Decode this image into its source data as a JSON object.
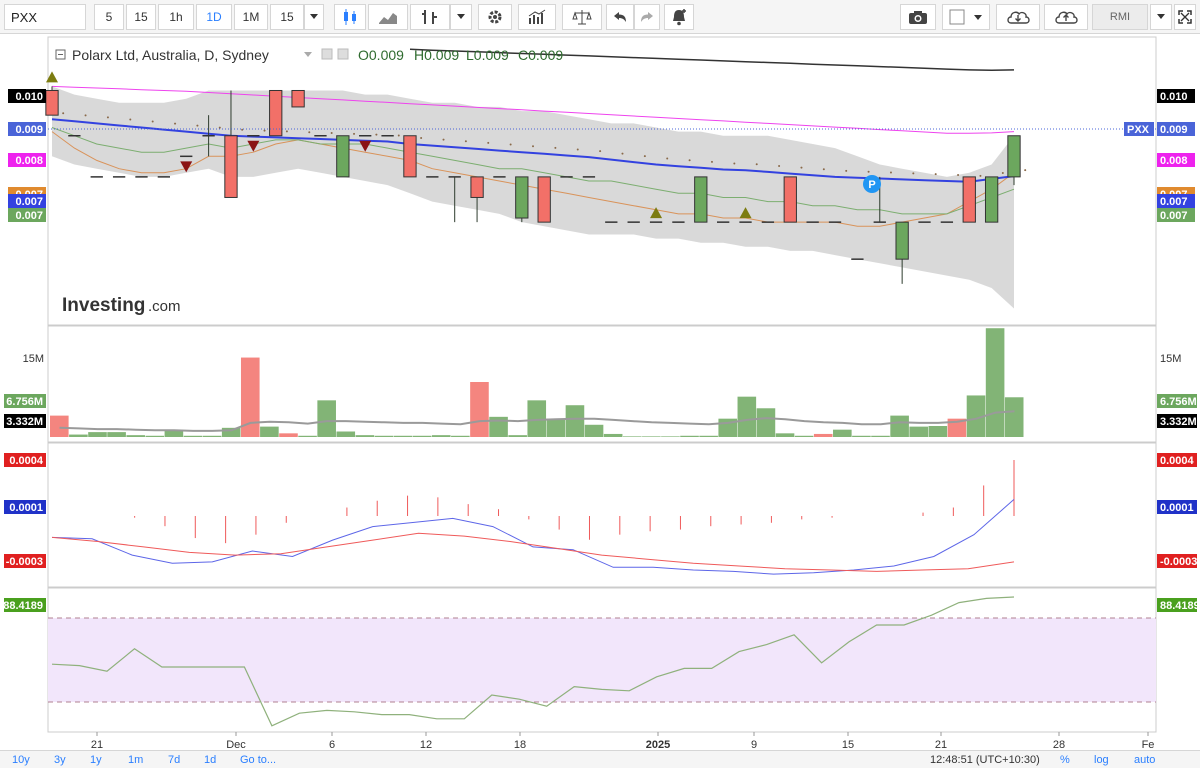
{
  "toolbar": {
    "symbol": "PXX",
    "intervals": [
      "5",
      "15",
      "1h",
      "1D",
      "1M",
      "15"
    ],
    "active_interval": "1D",
    "indicator_label": "RMI",
    "icons": [
      "candles-icon",
      "area-icon",
      "bars-icon",
      "dropdown-icon",
      "settings-icon",
      "indicators-icon",
      "compare-icon",
      "undo-icon",
      "redo-icon",
      "alert-icon",
      "camera-icon",
      "color-box-icon",
      "cloud-download-icon",
      "cloud-upload-icon"
    ]
  },
  "legend": {
    "title": "Polarx Ltd, Australia, D, Sydney",
    "open": "O0.009",
    "high": "H0.009",
    "low": "L0.009",
    "close": "C0.009"
  },
  "watermark": {
    "brand": "Investing",
    "suffix": ".com"
  },
  "colors": {
    "up": "#6ca75e",
    "down": "#f27068",
    "ma_blue": "#3342e0",
    "ma_magenta": "#ee44ee",
    "ma_dark": "#333333",
    "ma_green": "#7cae70",
    "ma_orange": "#d9935a",
    "bb_fill": "#d5d5d5",
    "macd": "#5d66e8",
    "signal": "#ef5a5a",
    "rsi": "#8fb17c",
    "rsi_zone": "#f2e6fb",
    "accent": "#2a7fff"
  },
  "chart_data": [
    {
      "type": "candlestick",
      "title": "Polarx Ltd, Australia, D, Sydney",
      "ylim": [
        0.0039,
        0.0109
      ],
      "axis_labels_right": [
        {
          "value": "0.010",
          "color": "#000000"
        },
        {
          "value": "0.009",
          "color": "#4a64d8"
        },
        {
          "value": "0.008",
          "color": "#ee22ee"
        },
        {
          "value": "0.007",
          "color": "#e08a2e"
        },
        {
          "value": "0.007",
          "color": "#3342e0"
        },
        {
          "value": "0.007",
          "color": "#6ca75e"
        }
      ],
      "price_tag": "PXX",
      "x_ticks": [
        "21",
        "Dec",
        "6",
        "12",
        "18",
        "2025",
        "9",
        "15",
        "21",
        "28",
        "Fe"
      ],
      "candles": [
        {
          "o": 0.0096,
          "h": 0.0097,
          "l": 0.009,
          "c": 0.009
        },
        {
          "o": 0.0085,
          "h": 0.0085,
          "l": 0.0085,
          "c": 0.0085
        },
        {
          "o": 0.0075,
          "h": 0.0075,
          "l": 0.0075,
          "c": 0.0075
        },
        {
          "o": 0.0075,
          "h": 0.0075,
          "l": 0.0075,
          "c": 0.0075
        },
        {
          "o": 0.0075,
          "h": 0.0075,
          "l": 0.0075,
          "c": 0.0075
        },
        {
          "o": 0.0075,
          "h": 0.0075,
          "l": 0.0075,
          "c": 0.0075
        },
        {
          "o": 0.008,
          "h": 0.008,
          "l": 0.008,
          "c": 0.008
        },
        {
          "o": 0.0085,
          "h": 0.009,
          "l": 0.008,
          "c": 0.0085
        },
        {
          "o": 0.0085,
          "h": 0.0096,
          "l": 0.007,
          "c": 0.007
        },
        {
          "o": 0.0085,
          "h": 0.0085,
          "l": 0.0085,
          "c": 0.0085
        },
        {
          "o": 0.0096,
          "h": 0.0096,
          "l": 0.0085,
          "c": 0.0085
        },
        {
          "o": 0.0096,
          "h": 0.0096,
          "l": 0.0092,
          "c": 0.0092
        },
        {
          "o": 0.0085,
          "h": 0.0085,
          "l": 0.0085,
          "c": 0.0085
        },
        {
          "o": 0.0075,
          "h": 0.0085,
          "l": 0.0075,
          "c": 0.0085
        },
        {
          "o": 0.0085,
          "h": 0.0085,
          "l": 0.0085,
          "c": 0.0085
        },
        {
          "o": 0.0085,
          "h": 0.0085,
          "l": 0.0085,
          "c": 0.0085
        },
        {
          "o": 0.0085,
          "h": 0.0085,
          "l": 0.0075,
          "c": 0.0075
        },
        {
          "o": 0.0075,
          "h": 0.0075,
          "l": 0.0075,
          "c": 0.0075
        },
        {
          "o": 0.0075,
          "h": 0.0075,
          "l": 0.0064,
          "c": 0.0075
        },
        {
          "o": 0.0075,
          "h": 0.0075,
          "l": 0.0064,
          "c": 0.007
        },
        {
          "o": 0.0075,
          "h": 0.0075,
          "l": 0.0075,
          "c": 0.0075
        },
        {
          "o": 0.0065,
          "h": 0.0075,
          "l": 0.0064,
          "c": 0.0075
        },
        {
          "o": 0.0075,
          "h": 0.0075,
          "l": 0.0064,
          "c": 0.0064
        },
        {
          "o": 0.0075,
          "h": 0.0075,
          "l": 0.0075,
          "c": 0.0075
        },
        {
          "o": 0.0075,
          "h": 0.0075,
          "l": 0.0075,
          "c": 0.0075
        },
        {
          "o": 0.0064,
          "h": 0.0064,
          "l": 0.0064,
          "c": 0.0064
        },
        {
          "o": 0.0064,
          "h": 0.0064,
          "l": 0.0064,
          "c": 0.0064
        },
        {
          "o": 0.0064,
          "h": 0.0064,
          "l": 0.0064,
          "c": 0.0064
        },
        {
          "o": 0.0064,
          "h": 0.0064,
          "l": 0.0064,
          "c": 0.0064
        },
        {
          "o": 0.0064,
          "h": 0.0075,
          "l": 0.0064,
          "c": 0.0075
        },
        {
          "o": 0.0064,
          "h": 0.0064,
          "l": 0.0064,
          "c": 0.0064
        },
        {
          "o": 0.0064,
          "h": 0.0064,
          "l": 0.0064,
          "c": 0.0064
        },
        {
          "o": 0.0064,
          "h": 0.0064,
          "l": 0.0064,
          "c": 0.0064
        },
        {
          "o": 0.0075,
          "h": 0.0075,
          "l": 0.0064,
          "c": 0.0064
        },
        {
          "o": 0.0064,
          "h": 0.0064,
          "l": 0.0064,
          "c": 0.0064
        },
        {
          "o": 0.0064,
          "h": 0.0064,
          "l": 0.0064,
          "c": 0.0064
        },
        {
          "o": 0.0055,
          "h": 0.0055,
          "l": 0.0055,
          "c": 0.0055
        },
        {
          "o": 0.0064,
          "h": 0.0075,
          "l": 0.0064,
          "c": 0.0064
        },
        {
          "o": 0.0055,
          "h": 0.0064,
          "l": 0.0049,
          "c": 0.0064
        },
        {
          "o": 0.0064,
          "h": 0.0064,
          "l": 0.0064,
          "c": 0.0064
        },
        {
          "o": 0.0064,
          "h": 0.0064,
          "l": 0.0064,
          "c": 0.0064
        },
        {
          "o": 0.0075,
          "h": 0.0075,
          "l": 0.0064,
          "c": 0.0064
        },
        {
          "o": 0.0064,
          "h": 0.0075,
          "l": 0.0064,
          "c": 0.0075
        },
        {
          "o": 0.0075,
          "h": 0.0085,
          "l": 0.0073,
          "c": 0.0085
        }
      ],
      "moving_averages": {
        "blue": [
          0.0089,
          0.00885,
          0.0088,
          0.00875,
          0.0087,
          0.00865,
          0.0086,
          0.00855,
          0.0085,
          0.00848,
          0.00846,
          0.00844,
          0.00842,
          0.0084,
          0.00838,
          0.00836,
          0.0083,
          0.00826,
          0.00822,
          0.00818,
          0.00814,
          0.0081,
          0.00806,
          0.00802,
          0.00798,
          0.00792,
          0.00786,
          0.0078,
          0.00776,
          0.00772,
          0.00768,
          0.00766,
          0.00762,
          0.00758,
          0.00754,
          0.0075,
          0.00748,
          0.00746,
          0.00744,
          0.00742,
          0.0074,
          0.00738,
          0.00745,
          0.00752
        ],
        "magenta": [
          0.0097,
          0.00968,
          0.00966,
          0.00964,
          0.00962,
          0.0096,
          0.00958,
          0.00955,
          0.00952,
          0.00949,
          0.00946,
          0.00943,
          0.0094,
          0.00937,
          0.00934,
          0.00931,
          0.00928,
          0.00925,
          0.00922,
          0.00919,
          0.00916,
          0.00913,
          0.0091,
          0.00907,
          0.00904,
          0.00901,
          0.00898,
          0.00895,
          0.00892,
          0.00889,
          0.00886,
          0.00883,
          0.0088,
          0.00877,
          0.00874,
          0.00871,
          0.00868,
          0.00865,
          0.00862,
          0.00859,
          0.00856,
          0.00856,
          0.00857,
          0.0086
        ],
        "dark": [
          null,
          null,
          null,
          null,
          null,
          null,
          null,
          null,
          null,
          null,
          null,
          null,
          null,
          null,
          null,
          null,
          0.0106,
          0.01058,
          0.01056,
          0.01054,
          0.01052,
          0.0105,
          0.01048,
          0.01046,
          0.01044,
          0.01042,
          0.0104,
          0.01038,
          0.01036,
          0.01034,
          0.01032,
          0.0103,
          0.01028,
          0.01026,
          0.01024,
          0.01022,
          0.0102,
          0.01018,
          0.01016,
          0.01014,
          0.01012,
          0.0101,
          0.01009,
          0.0101
        ],
        "green": [
          0.0087,
          0.0085,
          0.0083,
          0.0082,
          0.0081,
          0.0081,
          0.0082,
          0.0083,
          0.0082,
          0.0083,
          0.0084,
          0.0084,
          0.0083,
          0.0083,
          0.0083,
          0.0082,
          0.0081,
          0.008,
          0.0079,
          0.0078,
          0.0077,
          0.0077,
          0.0076,
          0.0075,
          0.0074,
          0.0074,
          0.0073,
          0.0072,
          0.0071,
          0.0071,
          0.007,
          0.007,
          0.0069,
          0.0069,
          0.0068,
          0.0068,
          0.0067,
          0.0067,
          0.0066,
          0.0066,
          0.0066,
          0.0068,
          0.007,
          0.0072
        ],
        "orange": [
          0.0086,
          0.0082,
          0.0079,
          0.0077,
          0.0076,
          0.0076,
          0.0077,
          0.008,
          0.008,
          0.0081,
          0.0083,
          0.0084,
          0.0083,
          0.0082,
          0.0081,
          0.008,
          0.0079,
          0.0077,
          0.0076,
          0.0075,
          0.0074,
          0.0073,
          0.0072,
          0.0071,
          0.007,
          0.0069,
          0.0068,
          0.0067,
          0.0066,
          0.0066,
          0.0065,
          0.0065,
          0.0064,
          0.0064,
          0.0064,
          0.0064,
          0.0063,
          0.0063,
          0.0064,
          0.0065,
          0.0066,
          0.0069,
          0.0072,
          0.0076
        ],
        "bb_upper": [
          0.0097,
          0.0095,
          0.0094,
          0.0093,
          0.0093,
          0.0093,
          0.0094,
          0.0096,
          0.0096,
          0.0096,
          0.0096,
          0.0096,
          0.0096,
          0.0096,
          0.0095,
          0.0095,
          0.0094,
          0.0093,
          0.0093,
          0.0092,
          0.0092,
          0.0091,
          0.0091,
          0.009,
          0.0089,
          0.0088,
          0.0088,
          0.0087,
          0.0086,
          0.0086,
          0.0085,
          0.0085,
          0.0085,
          0.0084,
          0.0083,
          0.0082,
          0.008,
          0.0078,
          0.0077,
          0.0076,
          0.0075,
          0.0076,
          0.0078,
          0.0085
        ],
        "bb_lower": [
          0.008,
          0.0078,
          0.0077,
          0.0076,
          0.0075,
          0.0075,
          0.0076,
          0.0077,
          0.0075,
          0.0075,
          0.0076,
          0.0077,
          0.0076,
          0.0075,
          0.0074,
          0.0073,
          0.0071,
          0.0069,
          0.0068,
          0.0067,
          0.0066,
          0.0064,
          0.0063,
          0.0062,
          0.0061,
          0.0061,
          0.0061,
          0.006,
          0.006,
          0.0059,
          0.0059,
          0.0058,
          0.0058,
          0.0057,
          0.0057,
          0.0056,
          0.0055,
          0.0054,
          0.0053,
          0.0052,
          0.0051,
          0.005,
          0.0048,
          0.0043
        ]
      },
      "up_arrows": [
        0,
        27,
        31
      ],
      "down_arrows": [
        6,
        9,
        14
      ],
      "dot_line": [
        0.0089,
        0.00885,
        0.0088,
        0.00875,
        0.0087,
        0.00865,
        0.0086,
        0.00855,
        0.0085,
        0.00848,
        0.00846,
        0.00844,
        0.00842,
        0.0084,
        0.00838,
        0.00836,
        0.0083,
        0.00826,
        0.00822,
        0.00818,
        0.00814,
        0.0081,
        0.00806,
        0.00802,
        0.00798,
        0.00792,
        0.00786,
        0.0078,
        0.00776,
        0.00772,
        0.00768,
        0.00766,
        0.00762,
        0.00758,
        0.00754,
        0.0075,
        0.00748,
        0.00746,
        0.00744,
        0.00742,
        0.0074,
        0.00738,
        0.00745,
        0.00752
      ],
      "marker_letter": "P"
    },
    {
      "type": "bar",
      "title": "Volume",
      "axis_labels_left": [
        "15M",
        "6.756M",
        "3.332M"
      ],
      "axis_labels_right": [
        "15M",
        "6.756M",
        "3.332M"
      ],
      "ylim": [
        0,
        18
      ],
      "values": [
        3.5,
        0.4,
        0.8,
        0.8,
        0.3,
        0.2,
        1.1,
        0.2,
        0.2,
        1.5,
        13.0,
        1.7,
        0.6,
        0.2,
        6.0,
        0.9,
        0.3,
        0.2,
        0.2,
        0.2,
        0.3,
        0.2,
        9.0,
        3.3,
        0.3,
        6.0,
        3.0,
        5.2,
        2.0,
        0.5,
        0.1,
        0.1,
        0.1,
        0.2,
        0.2,
        3.0,
        6.6,
        4.7,
        0.6,
        0.2,
        0.5,
        1.2,
        0.2,
        0.2,
        3.5,
        1.7,
        1.8,
        3.0,
        6.8,
        17.8,
        6.5
      ],
      "colors": [
        "down",
        "up",
        "up",
        "up",
        "up",
        "up",
        "up",
        "up",
        "up",
        "up",
        "down",
        "up",
        "down",
        "up",
        "up",
        "up",
        "up",
        "up",
        "up",
        "up",
        "up",
        "up",
        "down",
        "up",
        "up",
        "up",
        "up",
        "up",
        "up",
        "up",
        "up",
        "up",
        "up",
        "up",
        "up",
        "up",
        "up",
        "up",
        "up",
        "up",
        "down",
        "up",
        "up",
        "up",
        "up",
        "up",
        "up",
        "down",
        "up",
        "up",
        "up"
      ],
      "avg": [
        1.5,
        1.4,
        1.3,
        1.3,
        1.2,
        1.1,
        1.1,
        1.0,
        1.0,
        1.1,
        2.3,
        2.5,
        2.4,
        2.2,
        2.6,
        2.6,
        2.5,
        2.4,
        2.3,
        2.3,
        2.2,
        2.1,
        2.6,
        2.7,
        2.6,
        2.8,
        2.9,
        3.0,
        3.0,
        2.8,
        2.6,
        2.4,
        2.3,
        2.2,
        2.1,
        2.3,
        2.8,
        3.1,
        2.9,
        2.6,
        2.4,
        2.3,
        2.1,
        2.1,
        2.4,
        2.3,
        2.3,
        2.5,
        3.0,
        4.0,
        4.2
      ]
    },
    {
      "type": "bar",
      "title": "MACD",
      "axis_labels_left": [
        "0.0004",
        "0.0001",
        "-0.0003"
      ],
      "axis_labels_right": [
        "0.0004",
        "0.0001",
        "-0.0003"
      ],
      "ylim": [
        -0.00055,
        0.00048
      ],
      "histogram": [
        0,
        0,
        -1e-05,
        -6e-05,
        -0.00013,
        -0.00016,
        -0.00011,
        -4e-05,
        0,
        5e-05,
        9e-05,
        0.00012,
        0.00011,
        7e-05,
        4e-05,
        -2e-05,
        -8e-05,
        -0.00014,
        -0.00011,
        -9e-05,
        -8e-05,
        -6e-05,
        -5e-05,
        -4e-05,
        -2e-05,
        -1e-05,
        0,
        0,
        2e-05,
        5e-05,
        0.00018,
        0.00033
      ],
      "macd_line": [
        -0.0002,
        -0.00021,
        -0.00033,
        -0.00039,
        -0.00038,
        -0.0003,
        -0.00034,
        -0.00022,
        -0.00012,
        -9e-05,
        -6e-05,
        -0.00012,
        -0.00027,
        -0.00029,
        -0.00042,
        -0.00042,
        -0.00044,
        -0.00045,
        -0.00047,
        -0.00046,
        -0.00044,
        -0.00041,
        -0.00034,
        -0.00018,
        8e-05
      ],
      "signal_line": [
        -0.0002,
        -0.00023,
        -0.00027,
        -0.00031,
        -0.00033,
        -0.00032,
        -0.00027,
        -0.00022,
        -0.00017,
        -0.00019,
        -0.00023,
        -0.00028,
        -0.00033,
        -0.00036,
        -0.00039,
        -0.00041,
        -0.00043,
        -0.00044,
        -0.00045,
        -0.00044,
        -0.00043,
        -0.00038
      ]
    },
    {
      "type": "line",
      "title": "RMI",
      "axis_labels_left": [
        "88.4189"
      ],
      "axis_labels_right": [
        "88.4189"
      ],
      "ylim": [
        0,
        100
      ],
      "upper_band": 80,
      "lower_band": 20,
      "values": [
        47,
        46,
        42,
        58,
        45,
        45,
        45,
        45,
        3,
        12,
        14,
        13,
        11,
        11,
        8,
        8,
        25,
        22,
        17,
        31,
        29,
        28,
        38,
        44,
        44,
        56,
        61,
        68,
        48,
        63,
        75,
        75,
        82,
        91,
        94,
        95
      ]
    }
  ],
  "bottombar": {
    "ranges": [
      "10y",
      "3y",
      "1y",
      "1m",
      "7d",
      "1d"
    ],
    "goto": "Go to...",
    "clock": "12:48:51 (UTC+10:30)",
    "percent": "%",
    "log": "log",
    "auto": "auto"
  }
}
